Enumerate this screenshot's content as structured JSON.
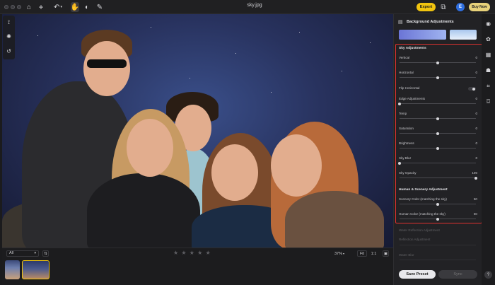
{
  "window": {
    "title": "sky.jpg"
  },
  "toolbar": {
    "export_label": "Export",
    "avatar_letter": "E",
    "buy_now_label": "Buy Now"
  },
  "bottom": {
    "filter_value": "All",
    "zoom_value": "37%",
    "fit_label": "Fit",
    "one_to_one_label": "1:1",
    "rating": "★ ★ ★ ★ ★"
  },
  "panel": {
    "title": "Background Adjustments",
    "sky_section_title": "Sky Adjustments",
    "sliders": [
      {
        "label": "Vertical",
        "value": "0",
        "level": 0.5
      },
      {
        "label": "Horizontal",
        "value": "0",
        "level": 0.5
      },
      {
        "label": "Edge Adjustments",
        "value": "0",
        "level": 0.0
      },
      {
        "label": "Temp",
        "value": "0",
        "level": 0.5
      },
      {
        "label": "Saturation",
        "value": "0",
        "level": 0.5
      },
      {
        "label": "Brightness",
        "value": "0",
        "level": 0.5
      },
      {
        "label": "Sky Blur",
        "value": "0",
        "level": 0.0
      },
      {
        "label": "Sky Opacity",
        "value": "100",
        "level": 1.0
      }
    ],
    "flip_label": "Flip Horizontal",
    "human_section_title": "Human & Scenery Adjustment",
    "human_sliders": [
      {
        "label": "Scenery Color (matching the sky)",
        "value": "50",
        "level": 0.5
      },
      {
        "label": "Human Color (matching the sky)",
        "value": "50",
        "level": 0.5
      }
    ],
    "dim_items": [
      "Water Reflection Adjustment",
      "Reflection Adjustment",
      "Water Blur"
    ],
    "save_preset_label": "Save Preset",
    "sync_label": "Sync"
  },
  "colors": {
    "accent": "#f1c40f",
    "highlight": "#e0312f",
    "avatar": "#2f6fe0"
  },
  "icons": {
    "top": [
      "home-icon",
      "plus-icon",
      "undo-icon",
      "hand-icon",
      "mask-icon",
      "brush-icon"
    ],
    "left": [
      "ai-erase-icon",
      "light-burst-icon",
      "history-icon"
    ],
    "right": [
      "eye-icon",
      "palette-icon",
      "layers-icon",
      "portrait-icon",
      "transform-icon",
      "camera-icon"
    ]
  }
}
